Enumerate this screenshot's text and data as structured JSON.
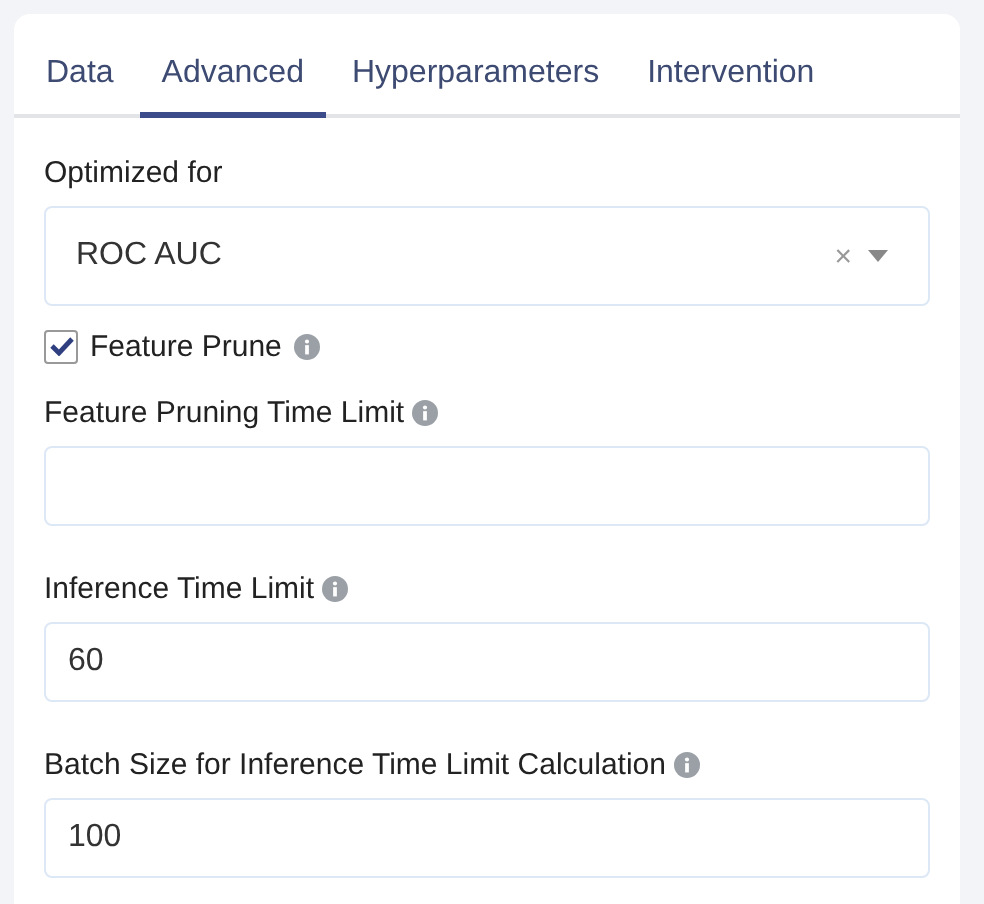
{
  "tabs": [
    {
      "label": "Data",
      "selected": false
    },
    {
      "label": "Advanced",
      "selected": true
    },
    {
      "label": "Hyperparameters",
      "selected": false
    },
    {
      "label": "Intervention",
      "selected": false
    }
  ],
  "fields": [
    {
      "kind": "select",
      "label": "Optimized for",
      "value": "ROC AUC",
      "clear": "×"
    },
    {
      "kind": "checkbox",
      "label": "Feature Prune",
      "checked": true,
      "info": true
    },
    {
      "kind": "text",
      "label": "Feature Pruning Time Limit",
      "info": true
    },
    {
      "kind": "text",
      "label": "Inference Time Limit",
      "value": "60",
      "info": true
    },
    {
      "kind": "text",
      "label": "Batch Size for Inference Time Limit Calculation",
      "value": "100",
      "info": true
    }
  ]
}
